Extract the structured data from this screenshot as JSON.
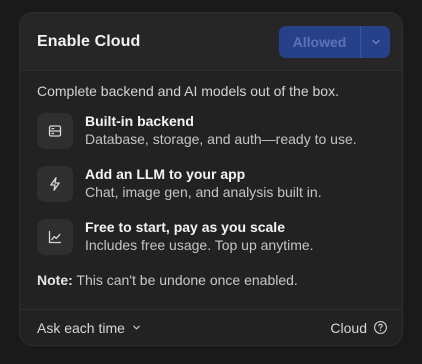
{
  "header": {
    "title": "Enable Cloud",
    "allowed_label": "Allowed"
  },
  "intro": "Complete backend and AI models out of the box.",
  "features": [
    {
      "icon": "server-icon",
      "title": "Built-in backend",
      "desc": "Database, storage, and auth—ready to use."
    },
    {
      "icon": "lightning-icon",
      "title": "Add an LLM to your app",
      "desc": "Chat, image gen, and analysis built in."
    },
    {
      "icon": "chart-icon",
      "title": "Free to start, pay as you scale",
      "desc": "Includes free usage. Top up anytime."
    }
  ],
  "note": {
    "label": "Note:",
    "text": " This can't be undone once enabled."
  },
  "footer": {
    "ask_label": "Ask each time",
    "cloud_label": "Cloud"
  },
  "colors": {
    "accent": "#27408a",
    "accent_text": "#5c73b8"
  }
}
